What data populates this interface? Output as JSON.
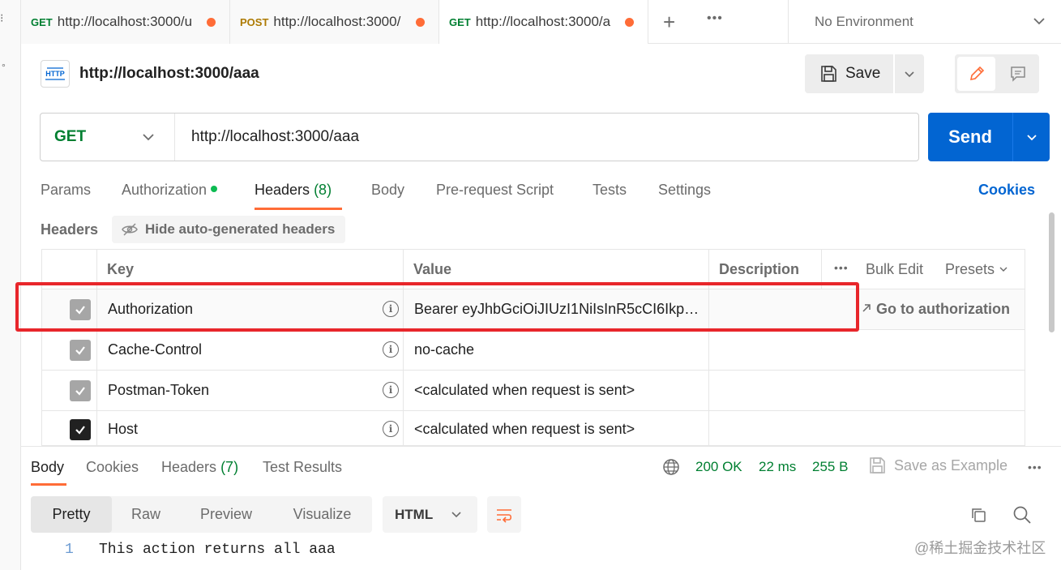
{
  "gutter": {
    "top_glyph": "⁝",
    "small_glyph": "°"
  },
  "tabs": [
    {
      "method": "GET",
      "url": "http://localhost:3000/u"
    },
    {
      "method": "POST",
      "url": "http://localhost:3000/"
    },
    {
      "method": "GET",
      "url": "http://localhost:3000/a"
    }
  ],
  "tabbar": {
    "more": "•••",
    "environment": "No Environment"
  },
  "request": {
    "title": "http://localhost:3000/aaa",
    "method": "GET",
    "url": "http://localhost:3000/aaa",
    "save_label": "Save",
    "send_label": "Send"
  },
  "request_tabs": {
    "params": "Params",
    "authorization": "Authorization",
    "headers": "Headers",
    "headers_count": "(8)",
    "body": "Body",
    "prerequest": "Pre-request Script",
    "tests": "Tests",
    "settings": "Settings",
    "cookies": "Cookies"
  },
  "headers_section": {
    "label": "Headers",
    "hide_label": "Hide auto-generated headers",
    "columns": {
      "key": "Key",
      "value": "Value",
      "description": "Description",
      "bulk_edit": "Bulk Edit",
      "presets": "Presets"
    },
    "more": "•••",
    "go_to_auth": "Go to authorization",
    "rows": [
      {
        "key": "Authorization",
        "value": "Bearer eyJhbGciOiJIUzI1NiIsInR5cCI6Ikp…",
        "checked": true
      },
      {
        "key": "Cache-Control",
        "value": "no-cache",
        "checked": true
      },
      {
        "key": "Postman-Token",
        "value": "<calculated when request is sent>",
        "checked": true
      },
      {
        "key": "Host",
        "value": "<calculated when request is sent>",
        "checked": true
      }
    ]
  },
  "response": {
    "tabs": {
      "body": "Body",
      "cookies": "Cookies",
      "headers": "Headers",
      "headers_count": "(7)",
      "test_results": "Test Results"
    },
    "status": "200 OK",
    "time": "22 ms",
    "size": "255 B",
    "save_example": "Save as Example",
    "more": "•••",
    "formats": {
      "pretty": "Pretty",
      "raw": "Raw",
      "preview": "Preview",
      "visualize": "Visualize"
    },
    "language": "HTML",
    "line_number": "1",
    "body_text": "This action returns all aaa"
  },
  "watermark": "@稀土掘金技术社区",
  "colors": {
    "accent": "#ff6c37",
    "send": "#0265d2",
    "get": "#007f31",
    "post": "#ad7a03",
    "highlight": "#e8262b"
  }
}
